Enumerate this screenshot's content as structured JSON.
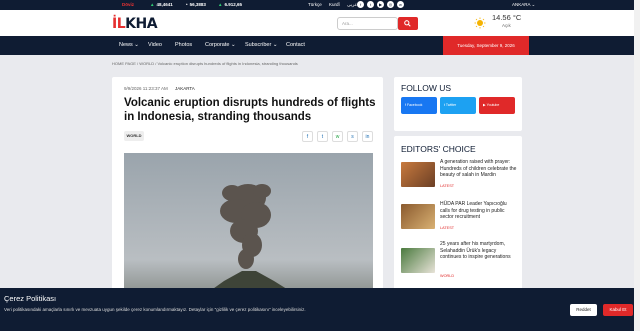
{
  "topbar": {
    "doviz": "Döviz",
    "tickers": [
      {
        "value": "48,4641"
      },
      {
        "value": "56,3883"
      },
      {
        "value": "6.912,65"
      }
    ],
    "langs": [
      "Türkçe",
      "Kurdî",
      "عربی"
    ],
    "city": "ANKARA"
  },
  "header": {
    "logo": "İLKHA",
    "search_placeholder": "Ara...",
    "weather": {
      "temp": "14.56 °C",
      "condition": "Açık"
    }
  },
  "nav": {
    "items": [
      "News",
      "Video",
      "Photos",
      "Corporate",
      "Subscriber",
      "Contact"
    ],
    "date": "Tuesday, September 9, 2026"
  },
  "breadcrumb": "HOME PAGE  /  WORLD  /  Volcanic eruption disrupts hundreds of flights in Indonesia, stranding thousands",
  "article": {
    "datetime": "9/9/2026 11:23:37 AM",
    "location": "JAKARTA",
    "title": "Volcanic eruption disrupts hundreds of flights in Indonesia, stranding thousands",
    "tag": "WORLD",
    "share": [
      "f",
      "t",
      "w",
      "s",
      "in"
    ]
  },
  "follow": {
    "heading": "FOLLOW US",
    "buttons": [
      {
        "label": "Facebook",
        "color": "#1877f2"
      },
      {
        "label": "Twitter",
        "color": "#1da1f2"
      },
      {
        "label": "Youtube",
        "color": "#e02929"
      }
    ]
  },
  "editors": {
    "heading": "EDITORS' CHOICE",
    "cards": [
      {
        "title": "A generation raised with prayer: Hundreds of children celebrate the beauty of salah in Mardin",
        "category": "LATEST"
      },
      {
        "title": "HÜDA PAR Leader Yapıcıoğlu calls for drug testing in public sector recruitment",
        "category": "LATEST"
      },
      {
        "title": "25 years after his martyrdom, Selahaddin Ürük's legacy continues to inspire generations",
        "category": "WORLD"
      }
    ]
  },
  "cookie": {
    "title": "Çerez Politikası",
    "text": "Veri politikasındaki amaçlarla sınırlı ve mevzuata uygun şekilde çerez konumlandırmaktayız. Detaylar için \"gizlilik ve çerez politikasını\" inceleyebilirsiniz.",
    "reject": "Reddet",
    "accept": "Kabul Et"
  },
  "colors": {
    "navy": "#0f1c33",
    "red": "#e02929"
  }
}
